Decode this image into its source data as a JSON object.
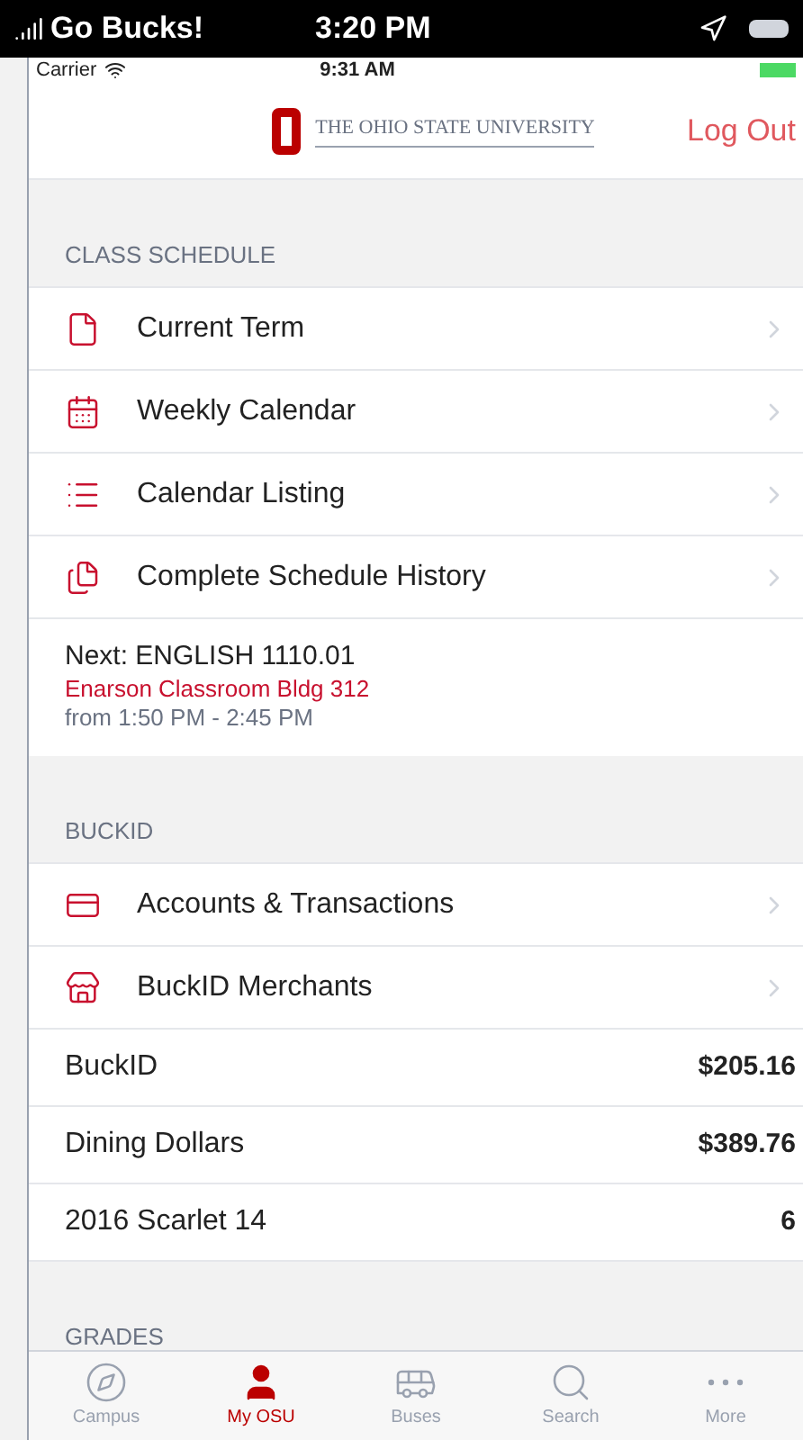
{
  "os_status": {
    "carrier": "Go Bucks!",
    "time": "3:20 PM"
  },
  "app_status": {
    "carrier": "Carrier",
    "time": "9:31 AM"
  },
  "header": {
    "logo_text": "THE OHIO STATE UNIVERSITY",
    "action": "Log Out"
  },
  "sections": [
    {
      "title": "CLASS SCHEDULE",
      "items": [
        {
          "kind": "link",
          "label": "Current Term"
        },
        {
          "kind": "link",
          "label": "Weekly Calendar"
        },
        {
          "kind": "link",
          "label": "Calendar Listing"
        },
        {
          "kind": "link",
          "label": "Complete Schedule History"
        },
        {
          "kind": "next",
          "label": "Next: ENGLISH 1110.01",
          "location": "Enarson Classroom Bldg 312",
          "time": "from 1:50 PM - 2:45 PM"
        }
      ]
    },
    {
      "title": "BUCKID",
      "items": [
        {
          "kind": "link",
          "label": "Accounts & Transactions"
        },
        {
          "kind": "link",
          "label": "BuckID Merchants"
        },
        {
          "kind": "value",
          "label": "BuckID",
          "value": "$205.16"
        },
        {
          "kind": "value",
          "label": "Dining Dollars",
          "value": "$389.76"
        },
        {
          "kind": "value",
          "label": "2016 Scarlet 14",
          "value": "6"
        }
      ]
    },
    {
      "title": "GRADES"
    }
  ],
  "tabs": [
    {
      "label": "Campus",
      "selected": false
    },
    {
      "label": "My OSU",
      "selected": true
    },
    {
      "label": "Buses",
      "selected": false
    },
    {
      "label": "Search",
      "selected": false
    },
    {
      "label": "More",
      "selected": false
    }
  ]
}
